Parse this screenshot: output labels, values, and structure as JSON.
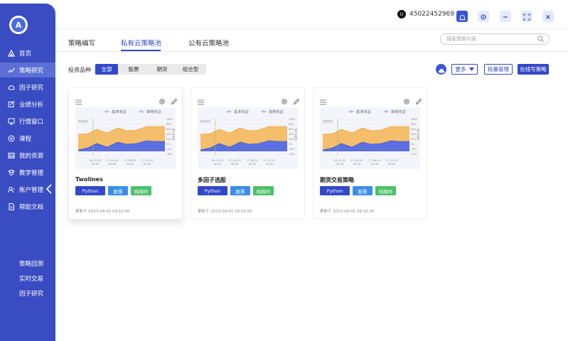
{
  "app": {
    "logo_letter": "A"
  },
  "sidebar": {
    "items": [
      {
        "label": "首页",
        "icon": "home-icon"
      },
      {
        "label": "策略研究",
        "icon": "trend-icon"
      },
      {
        "label": "因子研究",
        "icon": "cloud-icon"
      },
      {
        "label": "业绩分析",
        "icon": "chart-icon"
      },
      {
        "label": "行情窗口",
        "icon": "monitor-icon"
      },
      {
        "label": "课程",
        "icon": "course-icon"
      },
      {
        "label": "我的资源",
        "icon": "resource-icon"
      },
      {
        "label": "教学管理",
        "icon": "teach-icon"
      },
      {
        "label": "账户管理",
        "icon": "user-icon"
      },
      {
        "label": "帮助文档",
        "icon": "doc-icon"
      }
    ],
    "sub_items": [
      "策略回测",
      "实时交易",
      "因子研究"
    ],
    "active_color": "#5b6fd6",
    "bg_color": "#3a4cc1"
  },
  "topbar": {
    "account_id": "45022452969",
    "account_icon_text": "U"
  },
  "tabs": {
    "items": [
      "策略编写",
      "私有云策略池",
      "公有云策略池"
    ],
    "active": 1
  },
  "search": {
    "placeholder": "搜索策略列表"
  },
  "filter": {
    "label": "投资品种",
    "options": [
      "全部",
      "股票",
      "期货",
      "组合型"
    ],
    "selected": "全部"
  },
  "actions": {
    "more": "更多",
    "batch": "批量管理",
    "online": "在线写策略"
  },
  "chart_legend": [
    "基准收益",
    "策略收益"
  ],
  "chart_axis": {
    "left_note": "历史持仓",
    "x_ticks": [
      "16-12-01\n00:00",
      "17-04-01\n00:00",
      "17-08-01\n00:00",
      "17-12-01\n00:00"
    ],
    "y_ticks": [
      "100%",
      "80%",
      "60%",
      "40%",
      "20%",
      "0%",
      "-20%",
      "-40%"
    ],
    "y_title": "累计收益率"
  },
  "cards": [
    {
      "name": "Twolines",
      "tags": [
        "Python",
        "股票",
        "纯择时"
      ],
      "updated": "更新于 2023-09-01 09:10:00"
    },
    {
      "name": "多因子选股",
      "tags": [
        "Python",
        "股票",
        "纯择时"
      ],
      "updated": "更新于 2023-09-01 09:10:00"
    },
    {
      "name": "期货交易策略",
      "tags": [
        "Python",
        "股票",
        "纯择时"
      ],
      "updated": "更新于 2023-09-01 09:10:00"
    }
  ],
  "colors": {
    "primary": "#3348c8",
    "tag_python": "#3348c8",
    "tag_stock": "#3b8ee8",
    "tag_timing": "#4cc06a",
    "benchmark_area": "#f5b450",
    "strategy_area": "#5b6fe0"
  }
}
